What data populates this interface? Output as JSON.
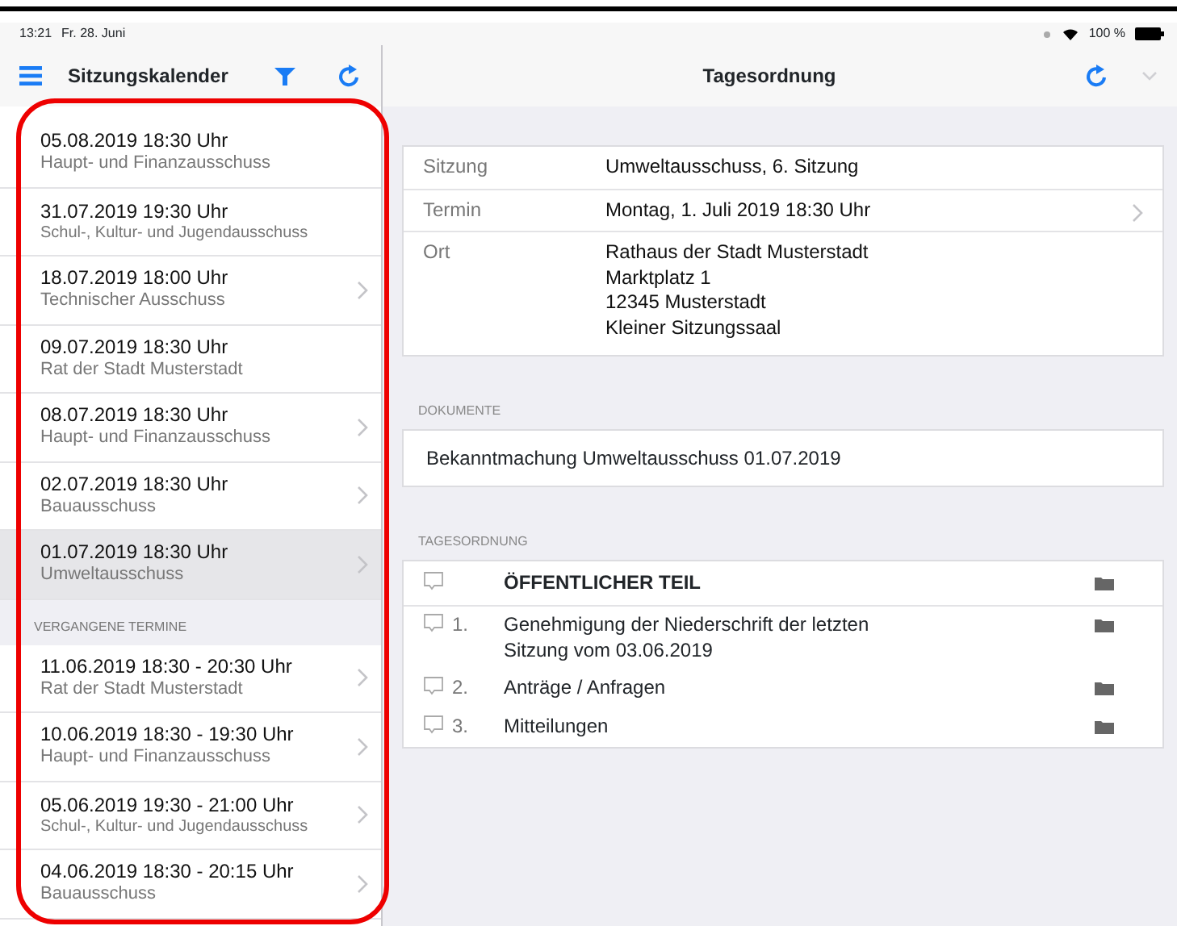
{
  "status_bar": {
    "time": "13:21",
    "date": "Fr. 28. Juni",
    "battery": "100 %"
  },
  "sidebar": {
    "title": "Sitzungskalender",
    "upcoming": [
      {
        "date": "05.08.2019 18:30 Uhr",
        "committee": "Haupt- und Finanzausschuss",
        "chevron": false,
        "selected": false
      },
      {
        "date": "31.07.2019 19:30 Uhr",
        "committee": "Schul-, Kultur- und Jugendausschuss",
        "chevron": false,
        "selected": false
      },
      {
        "date": "18.07.2019 18:00 Uhr",
        "committee": "Technischer Ausschuss",
        "chevron": true,
        "selected": false
      },
      {
        "date": "09.07.2019 18:30 Uhr",
        "committee": "Rat der Stadt Musterstadt",
        "chevron": false,
        "selected": false
      },
      {
        "date": "08.07.2019 18:30 Uhr",
        "committee": "Haupt- und Finanzausschuss",
        "chevron": true,
        "selected": false
      },
      {
        "date": "02.07.2019 18:30 Uhr",
        "committee": "Bauausschuss",
        "chevron": true,
        "selected": false
      },
      {
        "date": "01.07.2019 18:30 Uhr",
        "committee": "Umweltausschuss",
        "chevron": true,
        "selected": true
      }
    ],
    "past_header": "VERGANGENE TERMINE",
    "past": [
      {
        "date": "11.06.2019 18:30 -  20:30 Uhr",
        "committee": "Rat der Stadt Musterstadt",
        "chevron": true,
        "selected": false
      },
      {
        "date": "10.06.2019 18:30 -  19:30 Uhr",
        "committee": "Haupt- und Finanzausschuss",
        "chevron": true,
        "selected": false
      },
      {
        "date": "05.06.2019 19:30 -  21:00 Uhr",
        "committee": "Schul-, Kultur- und Jugendausschuss",
        "chevron": true,
        "selected": false
      },
      {
        "date": "04.06.2019 18:30 -  20:15 Uhr",
        "committee": "Bauausschuss",
        "chevron": true,
        "selected": false
      }
    ]
  },
  "detail": {
    "title": "Tagesordnung",
    "info": [
      {
        "label": "Sitzung",
        "lines": [
          "Umweltausschuss, 6. Sitzung"
        ],
        "chevron": false
      },
      {
        "label": "Termin",
        "lines": [
          "Montag, 1. Juli 2019 18:30 Uhr"
        ],
        "chevron": true
      },
      {
        "label": "Ort",
        "lines": [
          "Rathaus der Stadt Musterstadt",
          "Marktplatz 1",
          "12345 Musterstadt",
          "Kleiner Sitzungssaal"
        ],
        "chevron": false
      }
    ],
    "documents_header": "DOKUMENTE",
    "documents": [
      "Bekanntmachung Umweltausschuss 01.07.2019"
    ],
    "agenda_header": "TAGESORDNUNG",
    "agenda": [
      {
        "kind": "section",
        "title": "ÖFFENTLICHER TEIL"
      },
      {
        "kind": "item",
        "number": "1.",
        "title": "Genehmigung der Niederschrift der letzten Sitzung vom 03.06.2019"
      },
      {
        "kind": "item",
        "number": "2.",
        "title": "Anträge / Anfragen"
      },
      {
        "kind": "item",
        "number": "3.",
        "title": "Mitteilungen"
      }
    ]
  }
}
